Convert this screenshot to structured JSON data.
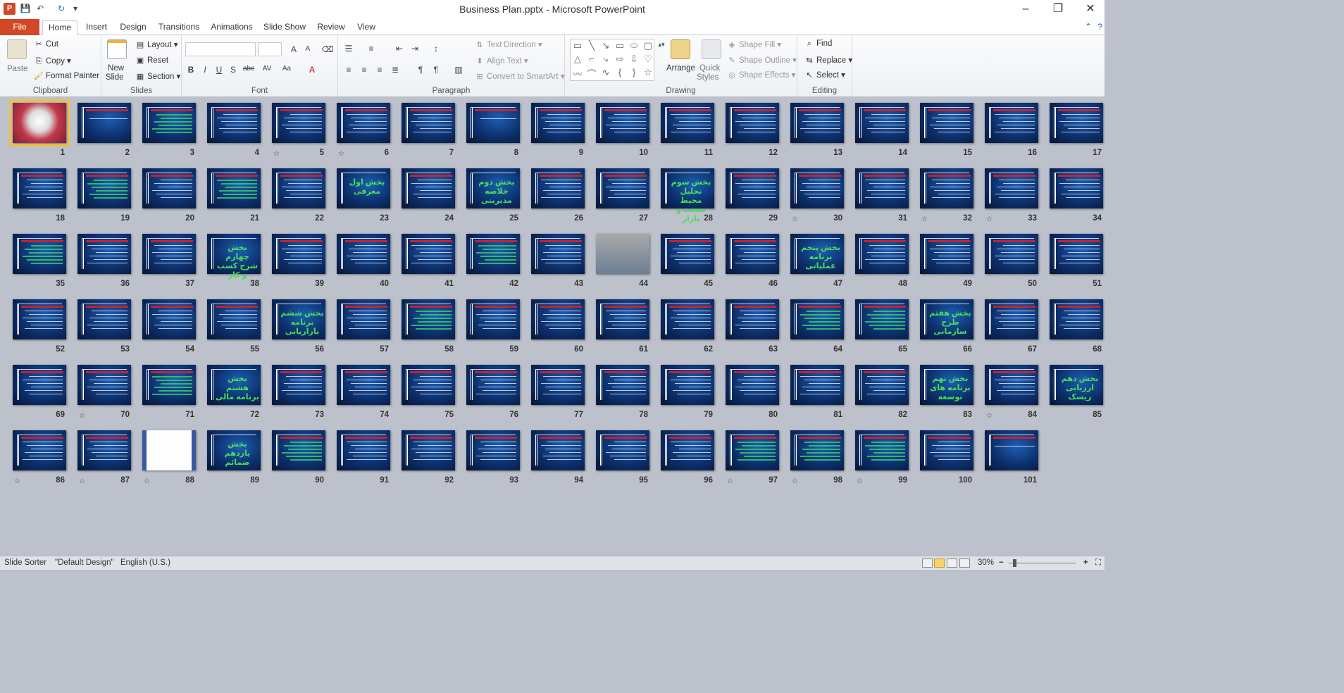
{
  "window": {
    "title": "Business Plan.pptx - Microsoft PowerPoint",
    "app_letter": "P"
  },
  "qat": {
    "save": "💾",
    "undo": "↶",
    "redo": "↻",
    "customize": "▾"
  },
  "tabs": [
    "File",
    "Home",
    "Insert",
    "Design",
    "Transitions",
    "Animations",
    "Slide Show",
    "Review",
    "View"
  ],
  "ribbon": {
    "clipboard": {
      "label": "Clipboard",
      "paste": "Paste",
      "cut": "Cut",
      "copy": "Copy",
      "format_painter": "Format Painter"
    },
    "slides": {
      "label": "Slides",
      "new_slide": "New",
      "new_slide2": "Slide",
      "layout": "Layout",
      "reset": "Reset",
      "section": "Section"
    },
    "font": {
      "label": "Font"
    },
    "paragraph": {
      "label": "Paragraph",
      "text_direction": "Text Direction",
      "align_text": "Align Text",
      "convert_smartart": "Convert to SmartArt"
    },
    "drawing": {
      "label": "Drawing",
      "arrange": "Arrange",
      "quick_styles": "Quick",
      "quick_styles2": "Styles",
      "shape_fill": "Shape Fill",
      "shape_outline": "Shape Outline",
      "shape_effects": "Shape Effects"
    },
    "editing": {
      "label": "Editing",
      "find": "Find",
      "replace": "Replace",
      "select": "Select"
    }
  },
  "slides": [
    {
      "n": "1",
      "kind": "image",
      "star": false
    },
    {
      "n": "2",
      "kind": "title",
      "star": false
    },
    {
      "n": "3",
      "kind": "table",
      "star": false
    },
    {
      "n": "4",
      "kind": "text",
      "star": false
    },
    {
      "n": "5",
      "kind": "text",
      "star": true
    },
    {
      "n": "6",
      "kind": "text",
      "star": true
    },
    {
      "n": "7",
      "kind": "text",
      "star": false
    },
    {
      "n": "8",
      "kind": "title",
      "star": false
    },
    {
      "n": "9",
      "kind": "text",
      "star": false
    },
    {
      "n": "10",
      "kind": "text",
      "star": false
    },
    {
      "n": "11",
      "kind": "text",
      "star": false
    },
    {
      "n": "12",
      "kind": "text",
      "star": false
    },
    {
      "n": "13",
      "kind": "text",
      "star": false
    },
    {
      "n": "14",
      "kind": "text",
      "star": false
    },
    {
      "n": "15",
      "kind": "text",
      "star": false
    },
    {
      "n": "16",
      "kind": "text",
      "star": false
    },
    {
      "n": "17",
      "kind": "text",
      "star": false
    },
    {
      "n": "18",
      "kind": "text",
      "star": false
    },
    {
      "n": "19",
      "kind": "diagram",
      "star": false
    },
    {
      "n": "20",
      "kind": "text",
      "star": false
    },
    {
      "n": "21",
      "kind": "diagram",
      "star": false
    },
    {
      "n": "22",
      "kind": "text",
      "star": false
    },
    {
      "n": "23",
      "kind": "big",
      "star": false,
      "big": "بخش اول معرفی"
    },
    {
      "n": "24",
      "kind": "text",
      "star": false
    },
    {
      "n": "25",
      "kind": "big",
      "star": false,
      "big": "بخش دوم خلاصه مدیریتی"
    },
    {
      "n": "26",
      "kind": "text",
      "star": false
    },
    {
      "n": "27",
      "kind": "text",
      "star": false
    },
    {
      "n": "28",
      "kind": "big",
      "star": false,
      "big": "بخش سوم تحلیل محیط صنعت و بازار"
    },
    {
      "n": "29",
      "kind": "text",
      "star": false
    },
    {
      "n": "30",
      "kind": "text",
      "star": true
    },
    {
      "n": "31",
      "kind": "text",
      "star": false
    },
    {
      "n": "32",
      "kind": "text",
      "star": true
    },
    {
      "n": "33",
      "kind": "text",
      "star": true
    },
    {
      "n": "34",
      "kind": "text",
      "star": false
    },
    {
      "n": "35",
      "kind": "diagram",
      "star": false
    },
    {
      "n": "36",
      "kind": "text",
      "star": false
    },
    {
      "n": "37",
      "kind": "text",
      "star": false
    },
    {
      "n": "38",
      "kind": "big",
      "star": false,
      "big": "بخش چهارم شرح کسب و کار"
    },
    {
      "n": "39",
      "kind": "text",
      "star": false
    },
    {
      "n": "40",
      "kind": "text",
      "star": false
    },
    {
      "n": "41",
      "kind": "text",
      "star": false
    },
    {
      "n": "42",
      "kind": "diagram",
      "star": false
    },
    {
      "n": "43",
      "kind": "text",
      "star": false
    },
    {
      "n": "44",
      "kind": "photo",
      "star": false
    },
    {
      "n": "45",
      "kind": "text",
      "star": false
    },
    {
      "n": "46",
      "kind": "text",
      "star": false
    },
    {
      "n": "47",
      "kind": "big",
      "star": false,
      "big": "بخش پنجم برنامه عملیاتی"
    },
    {
      "n": "48",
      "kind": "text",
      "star": false
    },
    {
      "n": "49",
      "kind": "text",
      "star": false
    },
    {
      "n": "50",
      "kind": "text",
      "star": false
    },
    {
      "n": "51",
      "kind": "text",
      "star": false
    },
    {
      "n": "52",
      "kind": "text",
      "star": false
    },
    {
      "n": "53",
      "kind": "text",
      "star": false
    },
    {
      "n": "54",
      "kind": "text",
      "star": false
    },
    {
      "n": "55",
      "kind": "text",
      "star": false
    },
    {
      "n": "56",
      "kind": "big",
      "star": false,
      "big": "بخش ششم برنامه بازاریابی"
    },
    {
      "n": "57",
      "kind": "text",
      "star": false
    },
    {
      "n": "58",
      "kind": "table",
      "star": false
    },
    {
      "n": "59",
      "kind": "text",
      "star": false
    },
    {
      "n": "60",
      "kind": "text",
      "star": false
    },
    {
      "n": "61",
      "kind": "text",
      "star": false
    },
    {
      "n": "62",
      "kind": "text",
      "star": false
    },
    {
      "n": "63",
      "kind": "text",
      "star": false
    },
    {
      "n": "64",
      "kind": "diagram",
      "star": false
    },
    {
      "n": "65",
      "kind": "diagram",
      "star": false
    },
    {
      "n": "66",
      "kind": "big",
      "star": false,
      "big": "بخش هفتم طرح سازمانی"
    },
    {
      "n": "67",
      "kind": "text",
      "star": false
    },
    {
      "n": "68",
      "kind": "text",
      "star": false
    },
    {
      "n": "69",
      "kind": "text",
      "star": false
    },
    {
      "n": "70",
      "kind": "text",
      "star": true
    },
    {
      "n": "71",
      "kind": "table",
      "star": false
    },
    {
      "n": "72",
      "kind": "big",
      "star": false,
      "big": "بخش هشتم برنامه مالی"
    },
    {
      "n": "73",
      "kind": "text",
      "star": false
    },
    {
      "n": "74",
      "kind": "text",
      "star": false
    },
    {
      "n": "75",
      "kind": "text",
      "star": false
    },
    {
      "n": "76",
      "kind": "text",
      "star": false
    },
    {
      "n": "77",
      "kind": "text",
      "star": false
    },
    {
      "n": "78",
      "kind": "text",
      "star": false
    },
    {
      "n": "79",
      "kind": "text",
      "star": false
    },
    {
      "n": "80",
      "kind": "text",
      "star": false
    },
    {
      "n": "81",
      "kind": "text",
      "star": false
    },
    {
      "n": "82",
      "kind": "text",
      "star": false
    },
    {
      "n": "83",
      "kind": "big",
      "star": false,
      "big": "بخش نهم برنامه های توسعه"
    },
    {
      "n": "84",
      "kind": "text",
      "star": true
    },
    {
      "n": "85",
      "kind": "big",
      "star": false,
      "big": "بخش دهم ارزیابی ریسک"
    },
    {
      "n": "86",
      "kind": "text",
      "star": true
    },
    {
      "n": "87",
      "kind": "text",
      "star": true
    },
    {
      "n": "88",
      "kind": "paper",
      "star": true
    },
    {
      "n": "89",
      "kind": "big",
      "star": false,
      "big": "بخش یازدهم ضمائم"
    },
    {
      "n": "90",
      "kind": "diagram",
      "star": false
    },
    {
      "n": "91",
      "kind": "text",
      "star": false
    },
    {
      "n": "92",
      "kind": "text",
      "star": false
    },
    {
      "n": "93",
      "kind": "text",
      "star": false
    },
    {
      "n": "94",
      "kind": "text",
      "star": false
    },
    {
      "n": "95",
      "kind": "text",
      "star": false
    },
    {
      "n": "96",
      "kind": "text",
      "star": false
    },
    {
      "n": "97",
      "kind": "diagram",
      "star": true
    },
    {
      "n": "98",
      "kind": "diagram",
      "star": true
    },
    {
      "n": "99",
      "kind": "diagram",
      "star": true
    },
    {
      "n": "100",
      "kind": "text",
      "star": false
    },
    {
      "n": "101",
      "kind": "title",
      "star": false
    }
  ],
  "status": {
    "view": "Slide Sorter",
    "theme": "\"Default Design\"",
    "language": "English (U.S.)",
    "zoom": "30%"
  },
  "colors": {
    "file_tab": "#d24726",
    "slide_bg": "#0c2f6b",
    "selection": "#f0c23c"
  }
}
